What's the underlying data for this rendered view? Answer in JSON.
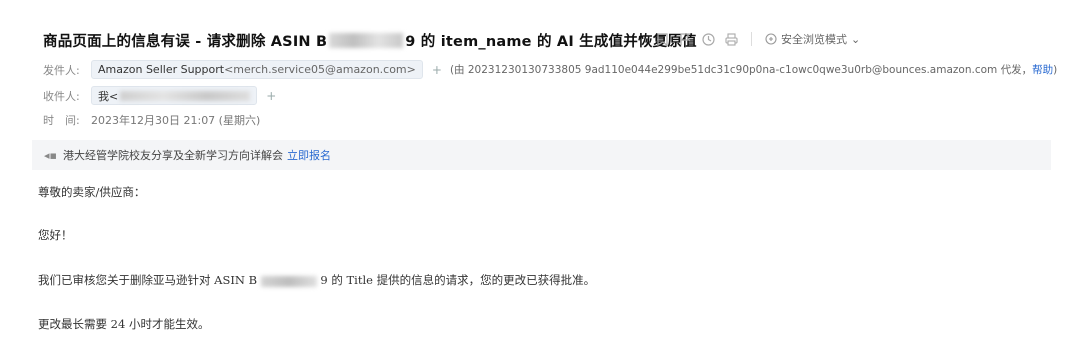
{
  "subject": {
    "prefix": "商品页面上的信息有误 - 请求删除 ASIN B",
    "suffix": "9 的 item_name 的 AI 生成值并恢复原值"
  },
  "toolbar": {
    "safe_browse_label": "安全浏览模式"
  },
  "sender": {
    "label": "发件人:",
    "name": "Amazon Seller Support",
    "email": "<merch.service05@amazon.com>",
    "add": "+",
    "proxy_prefix": "(由 20231230130733805 9ad110e044e299be51dc31c90p0na-c1owc0qwe3u0rb@bounces.amazon.com 代发，",
    "help": "帮助",
    "proxy_suffix": ")"
  },
  "recipient": {
    "label": "收件人:",
    "name": "我<",
    "add": "+"
  },
  "time": {
    "label": "时　间:",
    "value": "2023年12月30日 21:07 (星期六)"
  },
  "banner": {
    "text": "港大经管学院校友分享及全新学习方向详解会",
    "link": "立即报名"
  },
  "body": {
    "greeting": "尊敬的卖家/供应商：",
    "hello": "您好！",
    "line1_prefix": "我们已审核您关于删除亚马逊针对 ASIN B",
    "line1_suffix": "9 的 Title 提供的信息的请求，您的更改已获得批准。",
    "line2": "更改最长需要 24 小时才能生效。"
  }
}
